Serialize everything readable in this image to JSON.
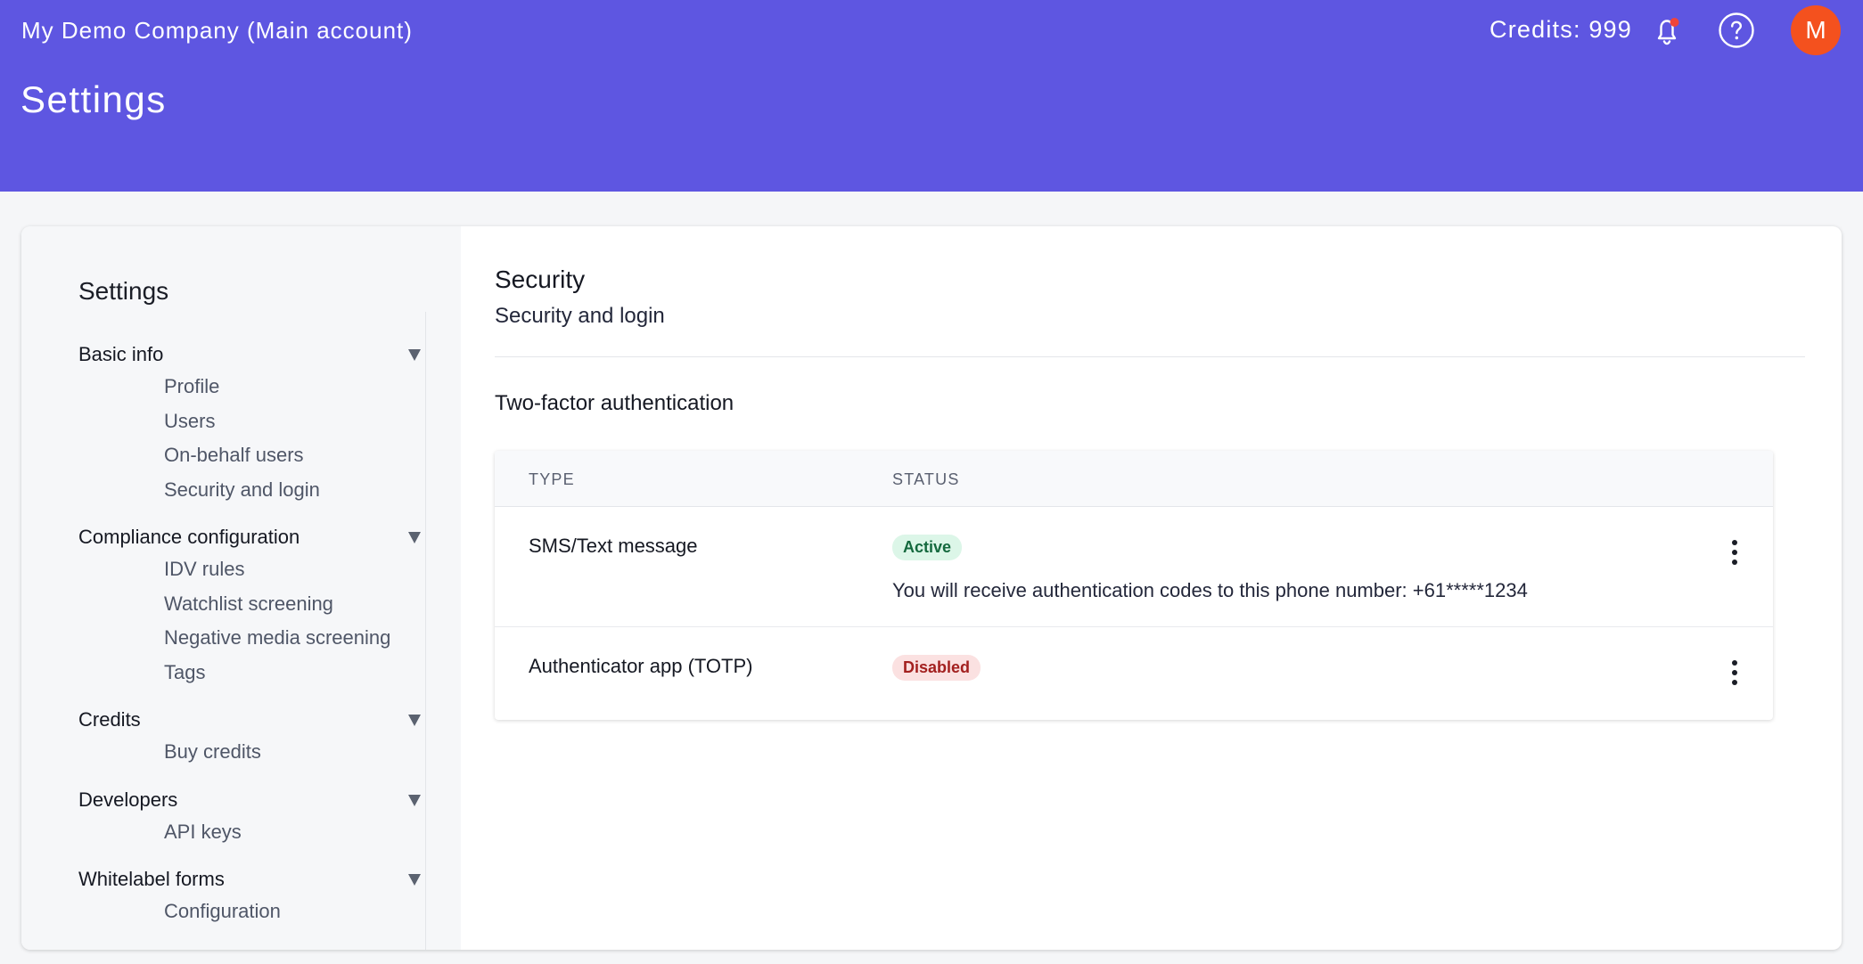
{
  "header": {
    "company": "My Demo Company (Main account)",
    "page_title": "Settings",
    "credits": "Credits: 999",
    "avatar_initial": "M",
    "bell_icon": "bell-icon",
    "help_icon": "help-circle-icon",
    "colors": {
      "bar": "#5e56e1",
      "avatar": "#f4511e",
      "notification_dot": "#f0443a"
    }
  },
  "sidebar": {
    "title": "Settings",
    "groups": [
      {
        "label": "Basic info",
        "items": [
          "Profile",
          "Users",
          "On-behalf users",
          "Security and login"
        ]
      },
      {
        "label": "Compliance configuration",
        "items": [
          "IDV rules",
          "Watchlist screening",
          "Negative media screening",
          "Tags"
        ]
      },
      {
        "label": "Credits",
        "items": [
          "Buy credits"
        ]
      },
      {
        "label": "Developers",
        "items": [
          "API keys"
        ]
      },
      {
        "label": "Whitelabel forms",
        "items": [
          "Configuration"
        ]
      }
    ]
  },
  "main": {
    "title": "Security",
    "subtitle": "Security and login",
    "section_title": "Two-factor authentication",
    "table": {
      "columns": [
        "TYPE",
        "STATUS"
      ],
      "rows": [
        {
          "type": "SMS/Text message",
          "status": "Active",
          "description": "You will receive authentication codes to this phone number: +61*****1234"
        },
        {
          "type": "Authenticator app (TOTP)",
          "status": "Disabled"
        }
      ]
    }
  }
}
